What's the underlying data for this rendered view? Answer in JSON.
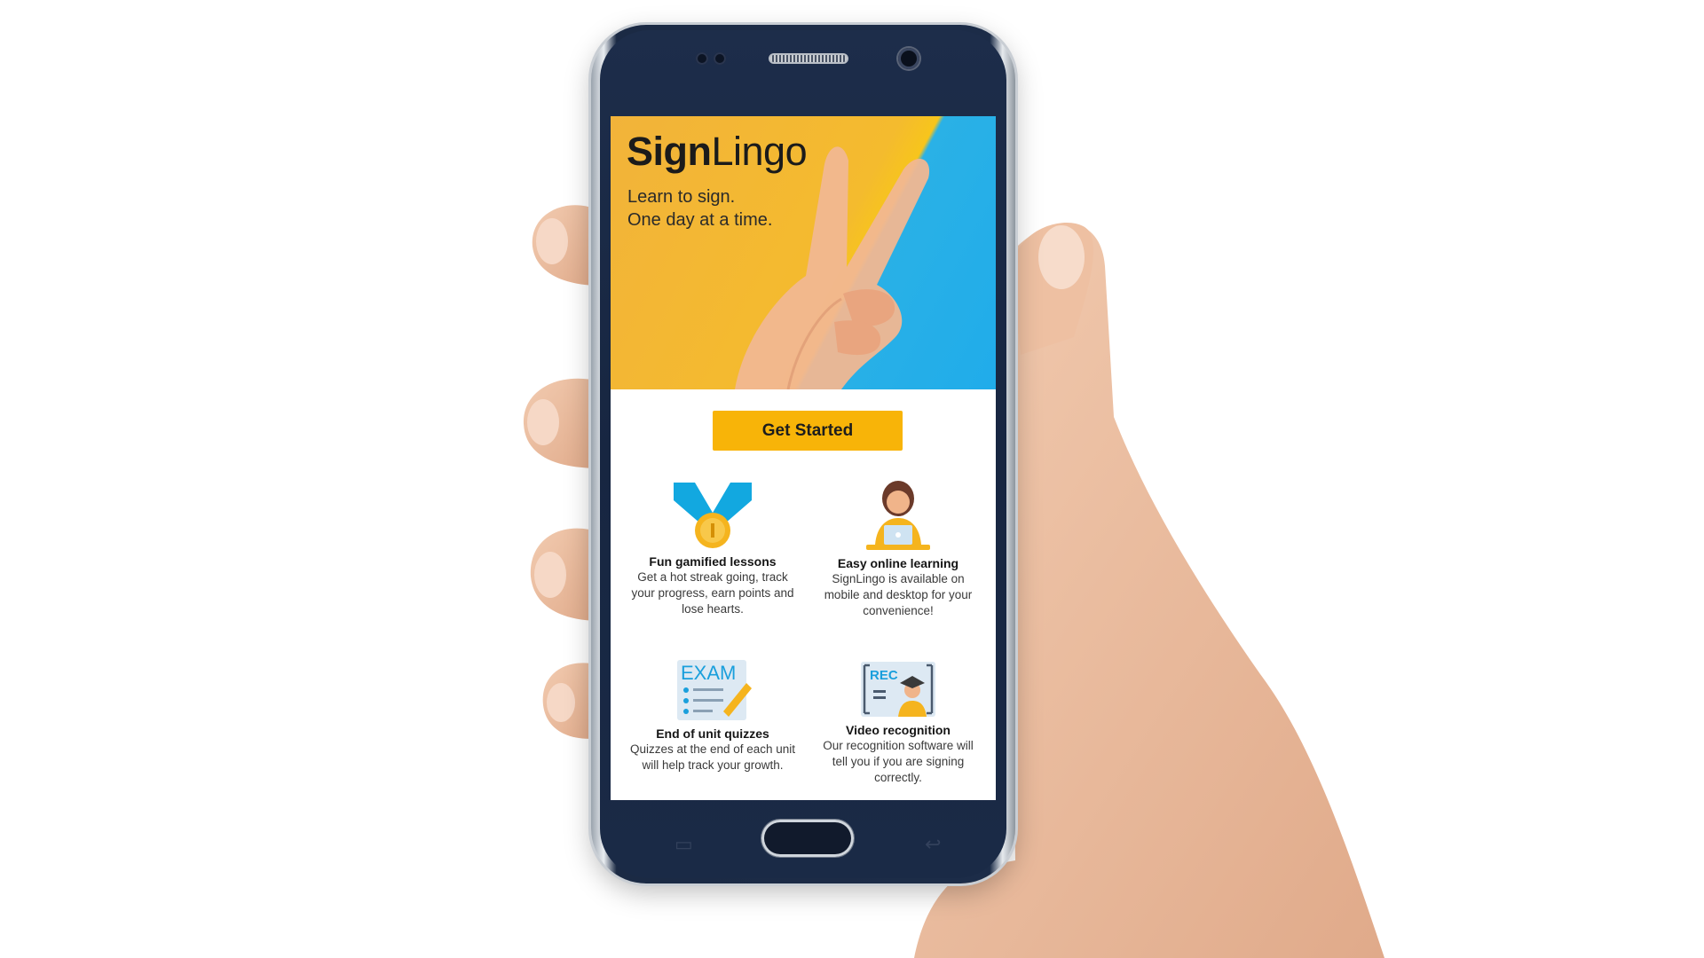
{
  "app": {
    "brand_bold": "Sign",
    "brand_regular": "Lingo",
    "tagline_line1": "Learn to sign.",
    "tagline_line2": "One day at a time."
  },
  "cta": {
    "label": "Get Started"
  },
  "features": [
    {
      "title": "Fun gamified lessons",
      "description": "Get a hot streak going, track your progress, earn points and lose hearts.",
      "icon": "medal-icon"
    },
    {
      "title": "Easy online learning",
      "description": "SignLingo is available on mobile and desktop for your convenience!",
      "icon": "person-laptop-icon"
    },
    {
      "title": "End of unit quizzes",
      "description": "Quizzes at the end of each unit will help track your growth.",
      "icon": "exam-icon"
    },
    {
      "title": "Video recognition",
      "description": "Our recognition software will tell you if you are signing correctly.",
      "icon": "video-rec-icon"
    }
  ],
  "icon_text": {
    "exam": "EXAM",
    "rec": "REC"
  },
  "colors": {
    "accent": "#f8b408",
    "hero_yellow": "#f4bb2e",
    "hero_blue": "#20acea",
    "phone_body": "#1c2c48"
  }
}
